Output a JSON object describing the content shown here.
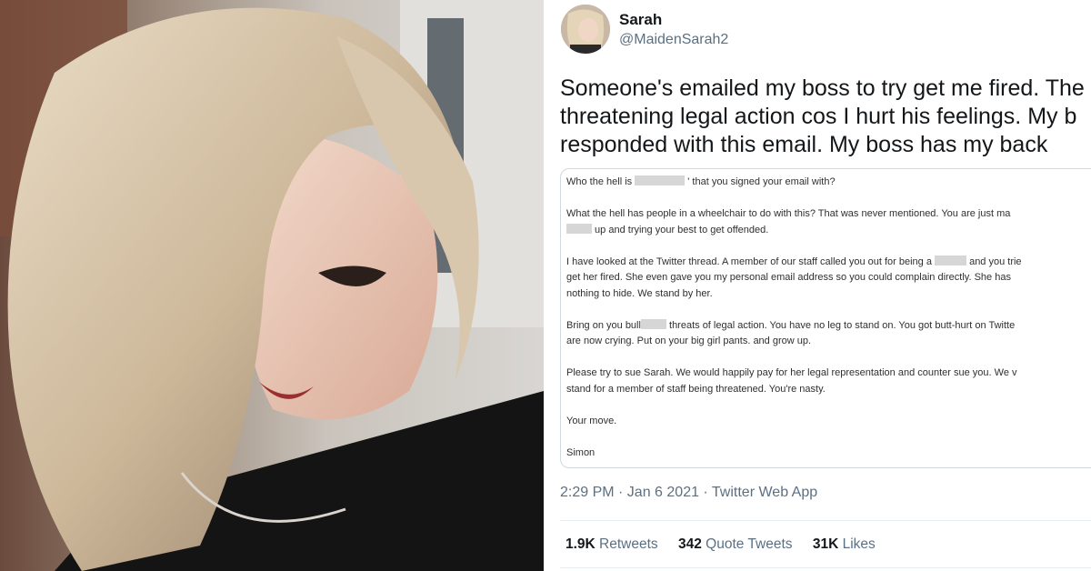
{
  "tweet": {
    "display_name": "Sarah",
    "handle": "@MaidenSarah2",
    "text_lines": [
      "Someone's emailed my boss to try get me fired. The",
      "threatening legal action cos I hurt his feelings. My b",
      "responded with this email. My boss has my back"
    ],
    "email": {
      "line1_a": "Who the hell is ",
      "line1_b": " ' that you signed your email with?",
      "line2": "What the hell has people in a wheelchair to do with this? That was never mentioned. You are just ma",
      "line3_b": " up and trying your best to get offended.",
      "line4_a": "I have looked at the Twitter thread. A member of our staff called you out for being a ",
      "line4_b": " and you trie",
      "line5": "get her fired. She even gave you my personal email address so you could complain directly. She has",
      "line6": "nothing to hide. We stand by her.",
      "line7_a": "Bring on you bull",
      "line7_b": " threats of legal action. You have no leg to stand on. You got butt-hurt on Twitte",
      "line8": "are now crying. Put on your big girl pants. and grow up.",
      "line9": "Please try to sue Sarah. We would happily pay for her legal representation and counter sue you. We v",
      "line10": "stand for a member of staff being threatened. You're nasty.",
      "line11": "Your move.",
      "line12": "Simon"
    },
    "meta": "2:29 PM · Jan 6  2021 · Twitter Web App",
    "stats": {
      "retweets_count": "1.9K",
      "retweets_label": " Retweets",
      "quotes_count": "342",
      "quotes_label": " Quote Tweets",
      "likes_count": "31K",
      "likes_label": " Likes"
    }
  },
  "colors": {
    "text_primary": "#14171a",
    "text_secondary": "#5b7083",
    "border": "#cfd9de"
  }
}
